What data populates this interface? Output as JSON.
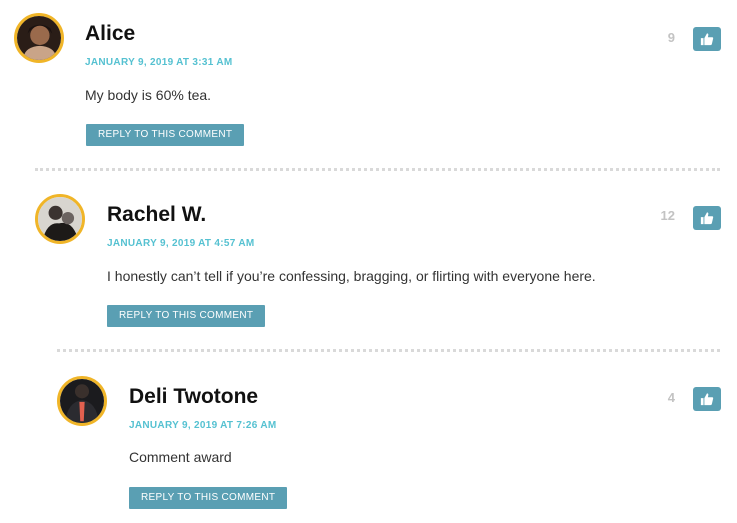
{
  "comments": [
    {
      "author": "Alice",
      "date": "JANUARY 9, 2019 AT 3:31 AM",
      "text": "My body is 60% tea.",
      "votes": "9",
      "reply_label": "REPLY TO THIS COMMENT"
    },
    {
      "author": "Rachel W.",
      "date": "JANUARY 9, 2019 AT 4:57 AM",
      "text": "I honestly can’t tell if you’re confessing, bragging, or flirting with everyone here.",
      "votes": "12",
      "reply_label": "REPLY TO THIS COMMENT"
    },
    {
      "author": "Deli Twotone",
      "date": "JANUARY 9, 2019 AT 7:26 AM",
      "text": "Comment award",
      "votes": "4",
      "reply_label": "REPLY TO THIS COMMENT"
    }
  ],
  "colors": {
    "accent": "#55c1d1",
    "button": "#5a9fb3",
    "avatar_ring": "#f0b528"
  },
  "icons": {
    "like": "thumbs-up-icon"
  }
}
